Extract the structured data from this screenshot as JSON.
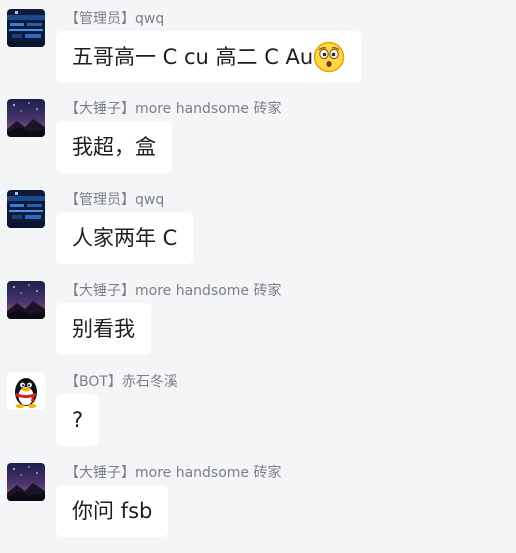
{
  "messages": [
    {
      "name": "【管理员】qwq",
      "text": "五哥高一 C cu 高二 C Au",
      "avatar": "blue-grid-avatar",
      "emoji": "astonished-face-icon"
    },
    {
      "name": "【大锤子】more handsome 砖家",
      "text": "我超，盒",
      "avatar": "night-sky-avatar"
    },
    {
      "name": "【管理员】qwq",
      "text": "人家两年 C",
      "avatar": "blue-grid-avatar"
    },
    {
      "name": "【大锤子】more handsome 砖家",
      "text": "别看我",
      "avatar": "night-sky-avatar"
    },
    {
      "name": "【BOT】赤石冬溪",
      "text": "?",
      "avatar": "penguin-avatar"
    },
    {
      "name": "【大锤子】more handsome 砖家",
      "text": "你问 fsb",
      "avatar": "night-sky-avatar"
    }
  ],
  "colors": {
    "background": "#f4f5f7",
    "bubble": "#ffffff",
    "name_text": "#7b7f86",
    "message_text": "#1d1d1f"
  }
}
